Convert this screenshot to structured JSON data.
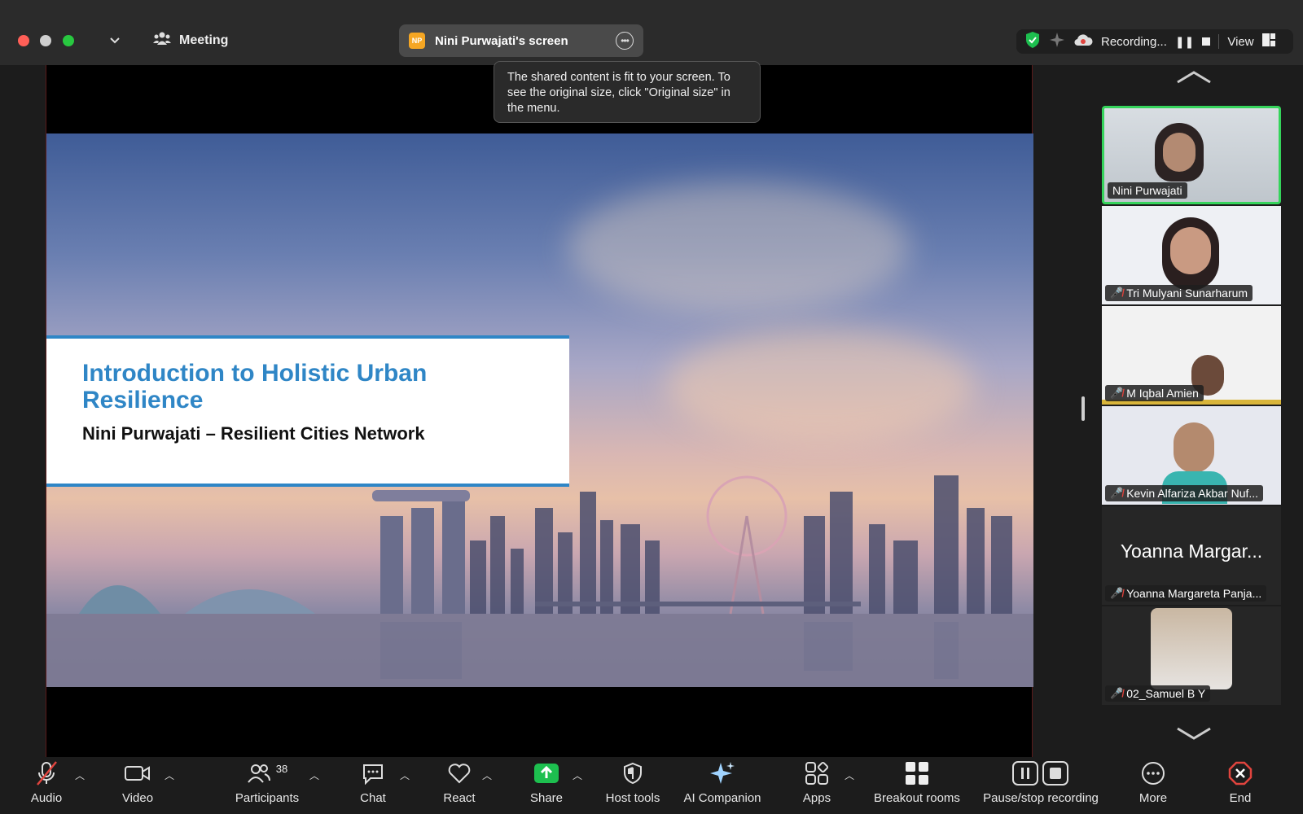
{
  "titlebar": {
    "meeting_label": "Meeting",
    "share_badge": "NP",
    "share_label": "Nini Purwajati's screen",
    "recording_label": "Recording...",
    "view_label": "View"
  },
  "tooltip": {
    "text": "The shared content is fit to your screen. To see the original size, click \"Original size\" in the menu."
  },
  "slide": {
    "title": "Introduction to Holistic Urban Resilience",
    "subtitle": "Nini Purwajati – Resilient Cities Network"
  },
  "participants_panel": {
    "tiles": [
      {
        "name": "Nini Purwajati",
        "muted": false
      },
      {
        "name": "Tri Mulyani Sunarharum",
        "muted": true
      },
      {
        "name": "M Iqbal Amien",
        "muted": true
      },
      {
        "name": "Kevin Alfariza Akbar Nuf...",
        "muted": true
      },
      {
        "name": "Yoanna Margareta Panja...",
        "display": "Yoanna Margar...",
        "muted": true
      },
      {
        "name": "02_Samuel B Y",
        "muted": true
      }
    ]
  },
  "toolbar": {
    "audio": "Audio",
    "video": "Video",
    "participants": "Participants",
    "participants_count": "38",
    "chat": "Chat",
    "react": "React",
    "share": "Share",
    "host_tools": "Host tools",
    "ai_companion": "AI Companion",
    "apps": "Apps",
    "breakout": "Breakout rooms",
    "pause_stop": "Pause/stop recording",
    "more": "More",
    "end": "End"
  },
  "colors": {
    "accent_green": "#35d45b",
    "share_green": "#1dbf4f",
    "end_red": "#e0443e",
    "slide_blue": "#2f86c6"
  }
}
